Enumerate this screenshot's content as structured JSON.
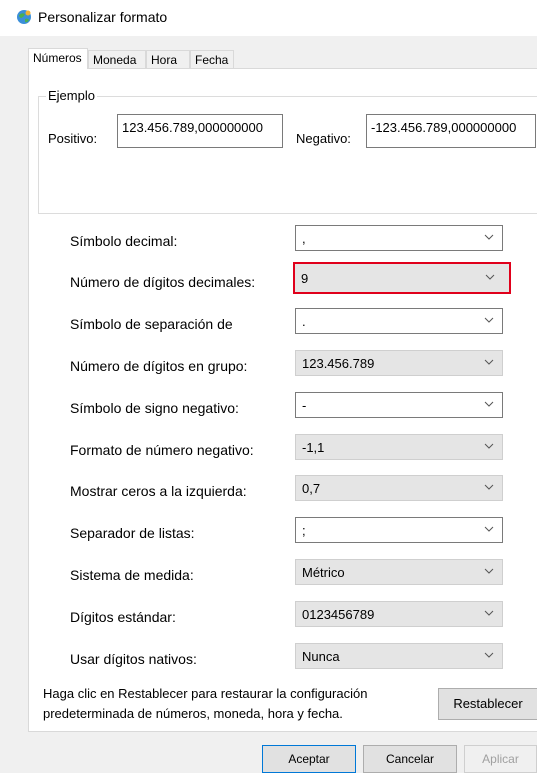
{
  "window": {
    "title": "Personalizar formato"
  },
  "tabs": [
    {
      "label": "Números",
      "active": true
    },
    {
      "label": "Moneda",
      "active": false
    },
    {
      "label": "Hora",
      "active": false
    },
    {
      "label": "Fecha",
      "active": false
    }
  ],
  "example": {
    "legend": "Ejemplo",
    "positive_label": "Positivo:",
    "positive_value": "123.456.789,000000000",
    "negative_label": "Negativo:",
    "negative_value": "-123.456.789,000000000"
  },
  "settings": [
    {
      "label": "Símbolo decimal:",
      "value": ",",
      "style": "edit"
    },
    {
      "label": "Número de dígitos decimales:",
      "value": "9",
      "style": "ro",
      "focused": true
    },
    {
      "label": "Símbolo de separación de",
      "value": ".",
      "style": "edit"
    },
    {
      "label": "Número de dígitos en grupo:",
      "value": "123.456.789",
      "style": "ro"
    },
    {
      "label": "Símbolo de signo negativo:",
      "value": "-",
      "style": "edit"
    },
    {
      "label": "Formato de número negativo:",
      "value": "-1,1",
      "style": "ro"
    },
    {
      "label": "Mostrar ceros a la izquierda:",
      "value": "0,7",
      "style": "ro"
    },
    {
      "label": "Separador de listas:",
      "value": ";",
      "style": "edit"
    },
    {
      "label": "Sistema de medida:",
      "value": "Métrico",
      "style": "ro"
    },
    {
      "label": "Dígitos estándar:",
      "value": "0123456789",
      "style": "ro"
    },
    {
      "label": "Usar dígitos nativos:",
      "value": "Nunca",
      "style": "ro"
    }
  ],
  "help_text": "Haga clic en Restablecer para restaurar la configuración predeterminada de números, moneda, hora y fecha.",
  "buttons": {
    "reset": "Restablecer",
    "ok": "Aceptar",
    "cancel": "Cancelar",
    "apply": "Aplicar"
  },
  "colors": {
    "focus_border": "#e0001b",
    "accent": "#0078d7"
  }
}
